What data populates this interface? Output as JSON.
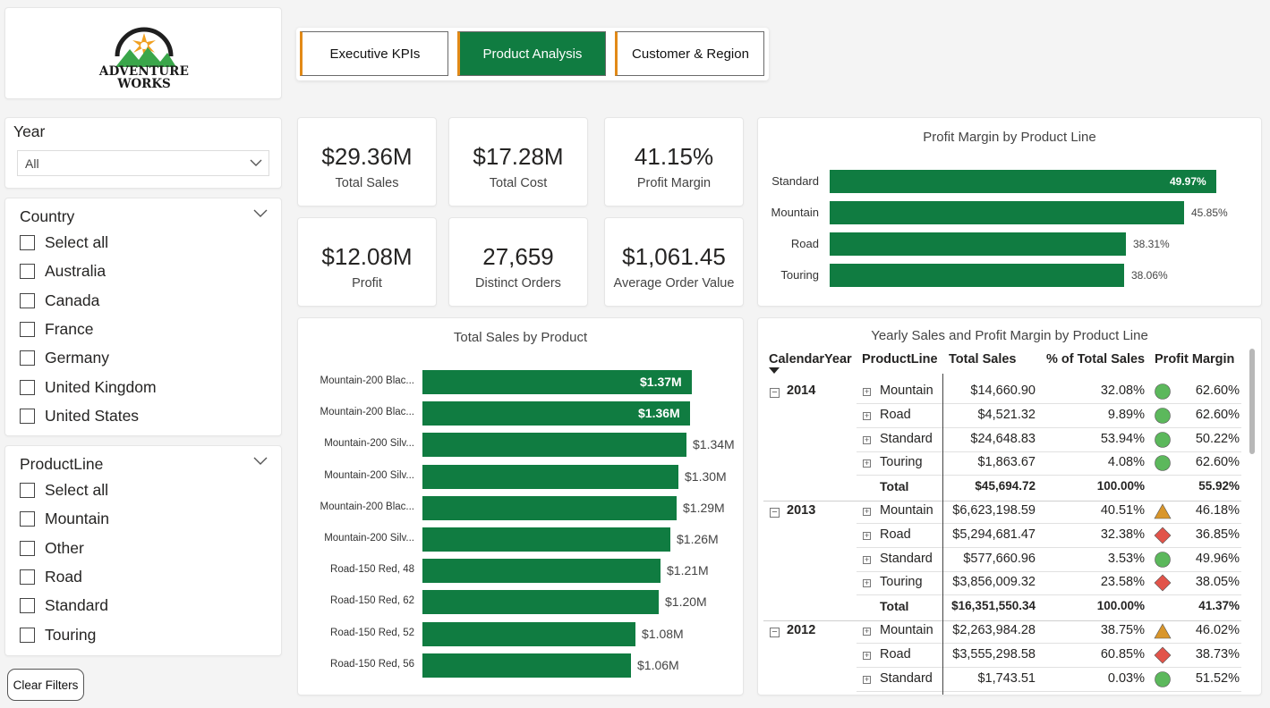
{
  "colors": {
    "accent": "#107c41",
    "nav_border": "#e28a17",
    "good": "#5cb85c",
    "warn": "#d9962b",
    "bad": "#e2544a"
  },
  "logo": {
    "line1": "Adventure",
    "line2": "Works"
  },
  "nav": [
    {
      "label": "Executive KPIs",
      "active": false
    },
    {
      "label": "Product Analysis",
      "active": true
    },
    {
      "label": "Customer & Region",
      "active": false
    }
  ],
  "year_slicer": {
    "title": "Year",
    "value": "All"
  },
  "country_slicer": {
    "title": "Country",
    "options": [
      "Select all",
      "Australia",
      "Canada",
      "France",
      "Germany",
      "United Kingdom",
      "United States"
    ]
  },
  "productline_slicer": {
    "title": "ProductLine",
    "options": [
      "Select all",
      "Mountain",
      "Other",
      "Road",
      "Standard",
      "Touring"
    ]
  },
  "clear_filters": "Clear Filters",
  "kpis": [
    {
      "value": "$29.36M",
      "label": "Total Sales"
    },
    {
      "value": "$17.28M",
      "label": "Total Cost"
    },
    {
      "value": "41.15%",
      "label": "Profit Margin"
    },
    {
      "value": "$12.08M",
      "label": "Profit"
    },
    {
      "value": "27,659",
      "label": "Distinct Orders"
    },
    {
      "value": "$1,061.45",
      "label": "Average Order Value"
    }
  ],
  "chart_data": [
    {
      "type": "bar",
      "title": "Profit Margin by Product Line",
      "categories": [
        "Standard",
        "Mountain",
        "Road",
        "Touring"
      ],
      "values": [
        49.97,
        45.85,
        38.31,
        38.06
      ],
      "labels": [
        "49.97%",
        "45.85%",
        "38.31%",
        "38.06%"
      ],
      "xlim": [
        0,
        50
      ]
    },
    {
      "type": "bar",
      "title": "Total Sales by Product",
      "categories": [
        "Mountain-200 Blac...",
        "Mountain-200 Blac...",
        "Mountain-200 Silv...",
        "Mountain-200 Silv...",
        "Mountain-200 Blac...",
        "Mountain-200 Silv...",
        "Road-150 Red, 48",
        "Road-150 Red, 62",
        "Road-150 Red, 52",
        "Road-150 Red, 56"
      ],
      "values": [
        1.37,
        1.36,
        1.34,
        1.3,
        1.29,
        1.26,
        1.21,
        1.2,
        1.08,
        1.06
      ],
      "labels": [
        "$1.37M",
        "$1.36M",
        "$1.34M",
        "$1.30M",
        "$1.29M",
        "$1.26M",
        "$1.21M",
        "$1.20M",
        "$1.08M",
        "$1.06M"
      ],
      "xlim": [
        0,
        1.4
      ]
    }
  ],
  "matrix": {
    "title": "Yearly Sales and Profit Margin by Product Line",
    "headers": [
      "CalendarYear",
      "ProductLine",
      "Total Sales",
      "% of Total Sales",
      "Profit Margin"
    ],
    "groups": [
      {
        "year": "2014",
        "rows": [
          {
            "line": "Mountain",
            "sales": "$14,660.90",
            "pct": "32.08%",
            "ind": "circle",
            "margin": "62.60%"
          },
          {
            "line": "Road",
            "sales": "$4,521.32",
            "pct": "9.89%",
            "ind": "circle",
            "margin": "62.60%"
          },
          {
            "line": "Standard",
            "sales": "$24,648.83",
            "pct": "53.94%",
            "ind": "circle",
            "margin": "50.22%"
          },
          {
            "line": "Touring",
            "sales": "$1,863.67",
            "pct": "4.08%",
            "ind": "circle",
            "margin": "62.60%"
          }
        ],
        "total": {
          "label": "Total",
          "sales": "$45,694.72",
          "pct": "100.00%",
          "margin": "55.92%"
        }
      },
      {
        "year": "2013",
        "rows": [
          {
            "line": "Mountain",
            "sales": "$6,623,198.59",
            "pct": "40.51%",
            "ind": "triangle",
            "margin": "46.18%"
          },
          {
            "line": "Road",
            "sales": "$5,294,681.47",
            "pct": "32.38%",
            "ind": "diamond",
            "margin": "36.85%"
          },
          {
            "line": "Standard",
            "sales": "$577,660.96",
            "pct": "3.53%",
            "ind": "circle",
            "margin": "49.96%"
          },
          {
            "line": "Touring",
            "sales": "$3,856,009.32",
            "pct": "23.58%",
            "ind": "diamond",
            "margin": "38.05%"
          }
        ],
        "total": {
          "label": "Total",
          "sales": "$16,351,550.34",
          "pct": "100.00%",
          "margin": "41.37%"
        }
      },
      {
        "year": "2012",
        "rows": [
          {
            "line": "Mountain",
            "sales": "$2,263,984.28",
            "pct": "38.75%",
            "ind": "triangle",
            "margin": "46.02%"
          },
          {
            "line": "Road",
            "sales": "$3,555,298.58",
            "pct": "60.85%",
            "ind": "diamond",
            "margin": "38.73%"
          },
          {
            "line": "Standard",
            "sales": "$1,743.51",
            "pct": "0.03%",
            "ind": "circle",
            "margin": "51.52%"
          }
        ]
      }
    ]
  }
}
